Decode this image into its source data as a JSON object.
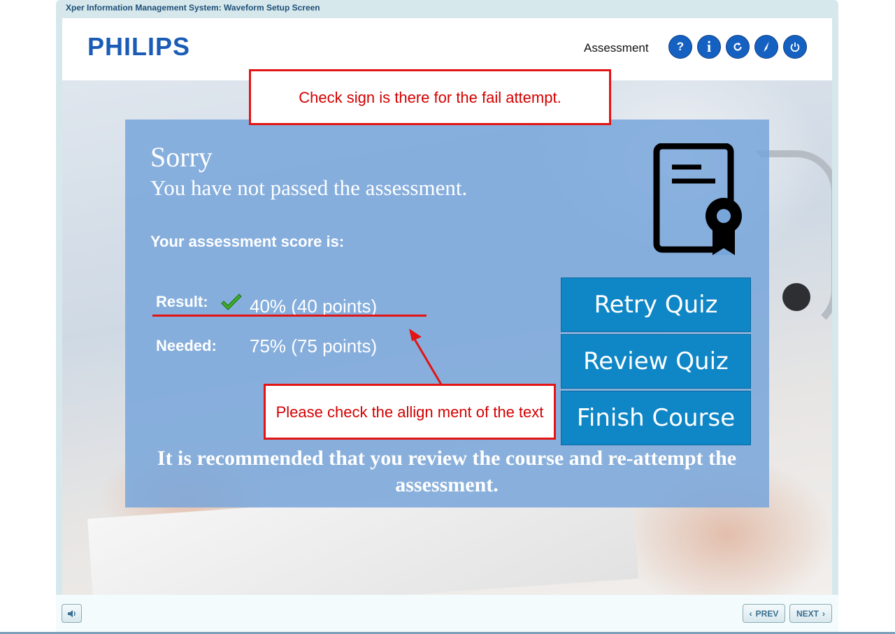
{
  "window": {
    "title": "Xper Information Management System: Waveform Setup Screen"
  },
  "header": {
    "logo": "PHILIPS",
    "title": "Assessment",
    "buttons": [
      {
        "name": "help",
        "glyph": "?"
      },
      {
        "name": "info",
        "glyph": "i"
      },
      {
        "name": "replay",
        "glyph": ""
      },
      {
        "name": "glossary",
        "glyph": ""
      },
      {
        "name": "exit",
        "glyph": ""
      }
    ]
  },
  "result_panel": {
    "heading": "Sorry",
    "subheading": "You have not passed the assessment.",
    "score_label": "Your assessment score is:",
    "result_label": "Result:",
    "result_value": "40% (40 points)",
    "needed_label": "Needed:",
    "needed_value": "75% (75 points)",
    "recommendation": "It is recommended that you review the course and re-attempt the assessment.",
    "buttons": {
      "retry": "Retry Quiz",
      "review": "Review Quiz",
      "finish": "Finish Course"
    }
  },
  "annotations": {
    "top_note": "Check sign is there for the fail attempt.",
    "bottom_note": "Please check the allign ment of the text",
    "color": "#e31414"
  },
  "footer": {
    "prev_label": "PREV",
    "next_label": "NEXT"
  },
  "colors": {
    "panel": "#78a6da",
    "button": "#0f86c6",
    "header_button": "#1561c2",
    "logo": "#1a5cb6"
  }
}
